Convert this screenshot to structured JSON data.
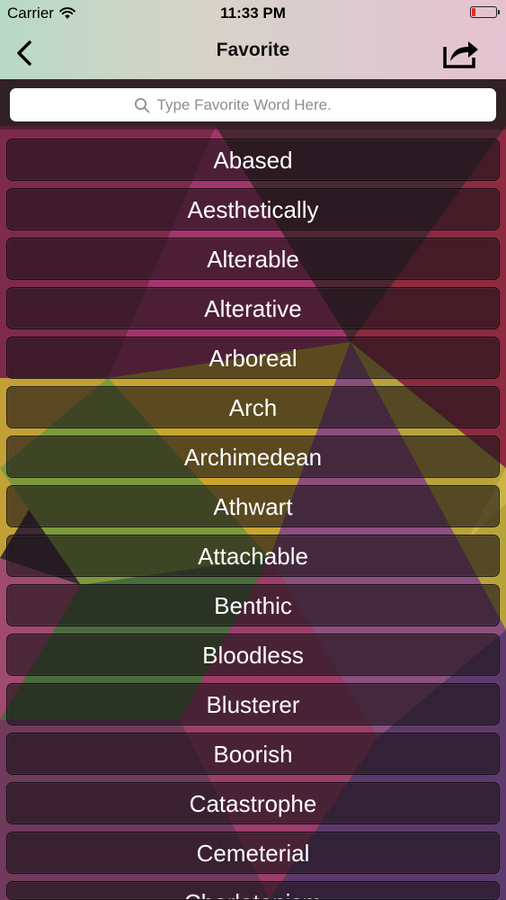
{
  "status_bar": {
    "carrier": "Carrier",
    "time": "11:33 PM"
  },
  "nav": {
    "title": "Favorite"
  },
  "search": {
    "placeholder": "Type Favorite Word Here."
  },
  "words": [
    "Abased",
    "Aesthetically",
    "Alterable",
    "Alterative",
    "Arboreal",
    "Arch",
    "Archimedean",
    "Athwart",
    "Attachable",
    "Benthic",
    "Bloodless",
    "Blusterer",
    "Boorish",
    "Catastrophe",
    "Cemeterial",
    "Charlatanism"
  ],
  "colors": {
    "battery_level": "#e8262b",
    "list_cell_background": "#1c1316"
  }
}
